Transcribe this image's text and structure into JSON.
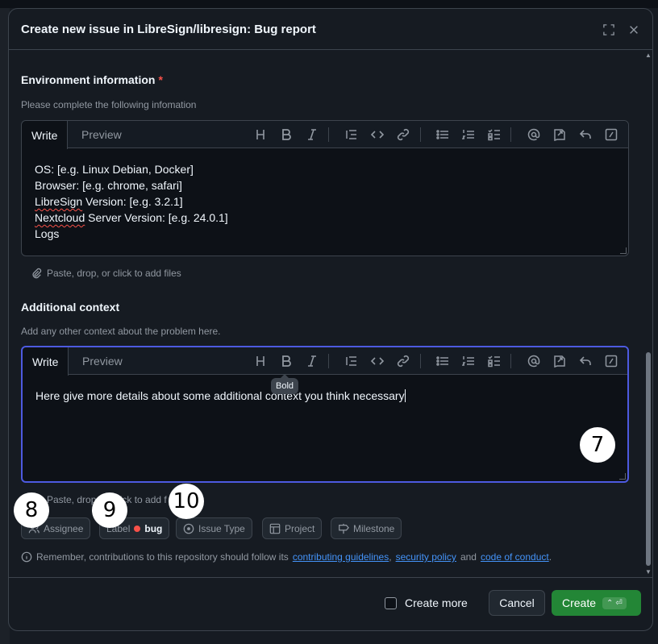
{
  "dialog": {
    "title": "Create new issue in LibreSign/libresign: Bug report",
    "expand_icon": "fullscreen-icon",
    "close_icon": "close-icon"
  },
  "env_field": {
    "label": "Environment information",
    "required_mark": "*",
    "hint": "Please complete the following infomation",
    "lines": [
      "OS: [e.g. Linux Debian, Docker]",
      "Browser: [e.g. chrome, safari]",
      "LibreSign Version: [e.g. 3.2.1]",
      "Nextcloud Server Version: [e.g. 24.0.1]",
      "Logs"
    ],
    "squiggle_words": [
      "LibreSign",
      "Nextcloud"
    ]
  },
  "editor": {
    "write_tab": "Write",
    "preview_tab": "Preview",
    "attach_text": "Paste, drop, or click to add files",
    "toolbar_icons": [
      "heading-icon",
      "bold-icon",
      "italic-icon",
      "quote-icon",
      "code-icon",
      "link-icon",
      "bulleted-list-icon",
      "numbered-list-icon",
      "task-list-icon",
      "mention-icon",
      "reference-icon",
      "undo-icon",
      "slash-command-icon"
    ]
  },
  "context_field": {
    "label": "Additional context",
    "hint": "Add any other context about the problem here.",
    "value": "Here give more details about some additional context you think necessary",
    "attach_partial": "Paste, drop, or click to add f"
  },
  "tooltip": {
    "text": "Bold"
  },
  "markers": {
    "seven": "7",
    "eight": "8",
    "nine": "9",
    "ten": "10"
  },
  "meta": {
    "assignee": "Assignee",
    "label": "Label",
    "label_value": "bug",
    "label_color": "#f85149",
    "issue_type": "Issue Type",
    "project": "Project",
    "milestone": "Milestone"
  },
  "note": {
    "prefix": "Remember, contributions to this repository should follow its",
    "link1": "contributing guidelines",
    "sep1": ",",
    "link2": "security policy",
    "sep2": "and",
    "link3": "code of conduct",
    "suffix": "."
  },
  "footer": {
    "create_more": "Create more",
    "cancel": "Cancel",
    "create": "Create",
    "create_shortcut": "⌃ ⏎",
    "accent": "#238636"
  }
}
